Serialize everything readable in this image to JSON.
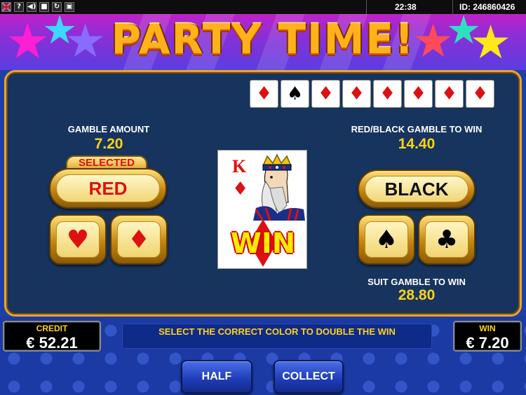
{
  "topbar": {
    "clock": "22:38",
    "game_id": "ID: 246860426",
    "icons": [
      "flag-uk-icon",
      "help-icon",
      "sound-icon",
      "fullscreen-icon",
      "reload-icon",
      "window-icon"
    ]
  },
  "title": "PARTY TIME!",
  "history": {
    "cards": [
      "♦",
      "♠",
      "♦",
      "♦",
      "♦",
      "♦",
      "♦",
      "♦"
    ],
    "colors": [
      "#d11",
      "#000",
      "#d11",
      "#d11",
      "#d11",
      "#d11",
      "#d11",
      "#d11"
    ]
  },
  "gamble": {
    "amount_label": "GAMBLE AMOUNT",
    "amount_value": "7.20",
    "selected_badge": "SELECTED",
    "red_label": "RED",
    "black_label": "BLACK",
    "redblack_label": "RED/BLACK GAMBLE TO WIN",
    "redblack_value": "14.40",
    "suit_label": "SUIT GAMBLE TO WIN",
    "suit_value": "28.80",
    "suits": {
      "hearts": "♥",
      "diamonds": "♦",
      "spades": "♠",
      "clubs": "♣"
    }
  },
  "card": {
    "rank": "K",
    "suit": "♦",
    "result": "WIN"
  },
  "footer": {
    "credit_label": "CREDIT",
    "credit_value": "€ 52.21",
    "message": "SELECT THE CORRECT COLOR TO DOUBLE THE WIN",
    "win_label": "WIN",
    "win_value": "€ 7.20",
    "half_label": "HALF",
    "collect_label": "COLLECT"
  },
  "colors": {
    "accent_gold": "#ffd21a",
    "red": "#dd1111",
    "panel": "#16345e"
  }
}
